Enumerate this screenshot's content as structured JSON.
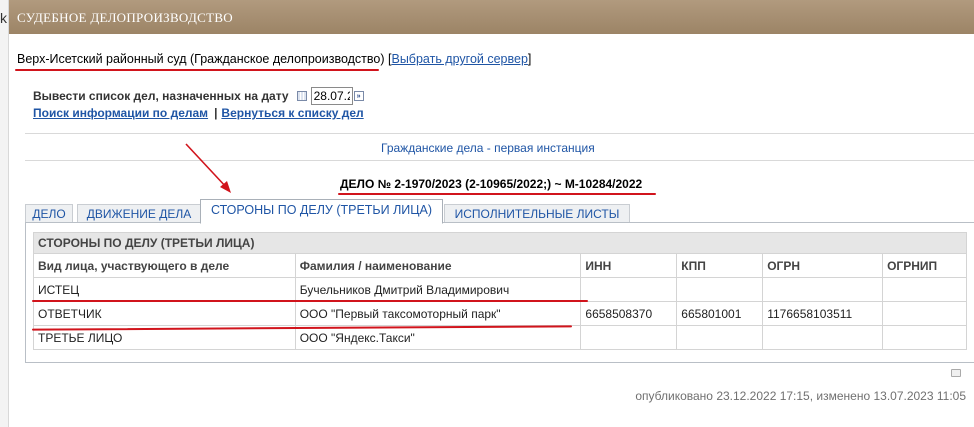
{
  "edge_char": "k",
  "header": {
    "title": "СУДЕБНОЕ ДЕЛОПРОИЗВОДСТВО"
  },
  "court": {
    "name": "Верх-Исетский районный суд (Гражданское делопроизводство)",
    "bracket_open": "[",
    "bracket_close": "]",
    "change_server_link": "Выбрать другой сервер"
  },
  "date_filter": {
    "label": "Вывести список дел, назначенных на дату",
    "value": "28.07.2",
    "go_glyph": "»"
  },
  "links": {
    "search": "Поиск информации по делам",
    "separator": "|",
    "back": "Вернуться к списку дел"
  },
  "instance": "Гражданские дела - первая инстанция",
  "case_number": "ДЕЛО № 2-1970/2023 (2-10965/2022;) ~ М-10284/2022",
  "tabs": [
    {
      "label": "ДЕЛО",
      "active": false
    },
    {
      "label": "ДВИЖЕНИЕ ДЕЛА",
      "active": false
    },
    {
      "label": "СТОРОНЫ ПО ДЕЛУ (ТРЕТЬИ ЛИЦА)",
      "active": true
    },
    {
      "label": "ИСПОЛНИТЕЛЬНЫЕ ЛИСТЫ",
      "active": false
    }
  ],
  "parties_table": {
    "caption": "СТОРОНЫ ПО ДЕЛУ (ТРЕТЬИ ЛИЦА)",
    "columns": [
      "Вид лица, участвующего в деле",
      "Фамилия / наименование",
      "ИНН",
      "КПП",
      "ОГРН",
      "ОГРНИП"
    ],
    "rows": [
      [
        "ИСТЕЦ",
        "Бучельников Дмитрий Владимирович",
        "",
        "",
        "",
        ""
      ],
      [
        "ОТВЕТЧИК",
        "ООО \"Первый таксомоторный парк\"",
        "6658508370",
        "665801001",
        "1176658103511",
        ""
      ],
      [
        "ТРЕТЬЕ ЛИЦО",
        "ООО \"Яндекс.Такси\"",
        "",
        "",
        "",
        ""
      ]
    ]
  },
  "footer": "опубликовано 23.12.2022 17:15, изменено 13.07.2023 11:05",
  "colors": {
    "header_bar": "#a88f72",
    "link": "#1f55a5",
    "annotation": "#d1141c"
  },
  "icons": [
    "calendar-icon",
    "go-arrow-icon",
    "print-icon",
    "annotation-arrow"
  ]
}
